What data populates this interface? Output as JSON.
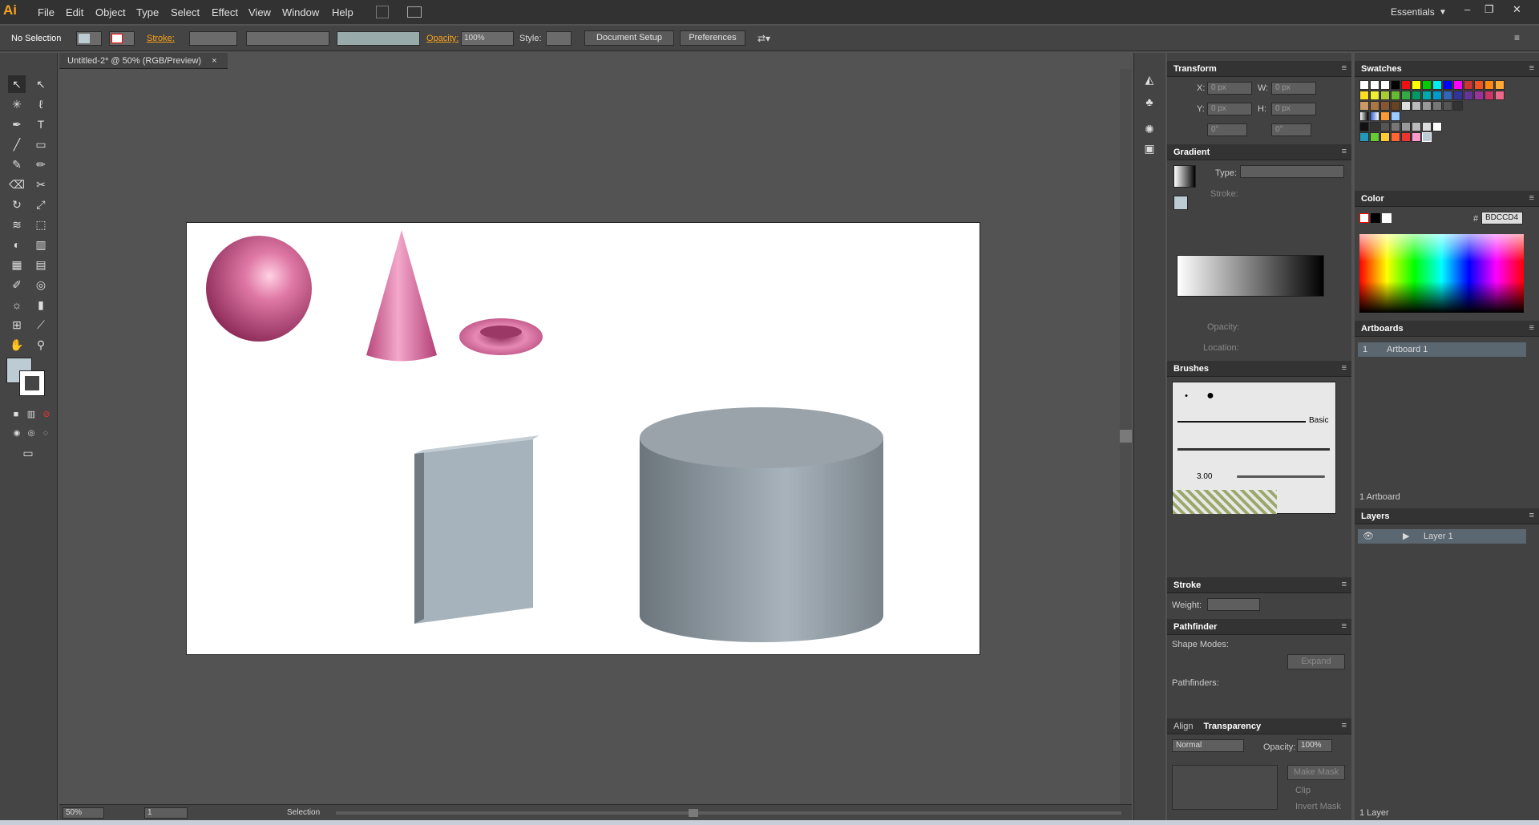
{
  "menubar": {
    "logo": "Ai",
    "items": [
      "File",
      "Edit",
      "Object",
      "Type",
      "Select",
      "Effect",
      "View",
      "Window",
      "Help"
    ],
    "workspace": "Essentials"
  },
  "controlbar": {
    "selection": "No Selection",
    "stroke_label": "Stroke:",
    "opacity_label": "Opacity:",
    "opacity_value": "100%",
    "style_label": "Style:",
    "document_setup": "Document Setup",
    "preferences": "Preferences"
  },
  "document": {
    "tab_title": "Untitled-2* @ 50% (RGB/Preview)"
  },
  "statusbar": {
    "zoom": "50%",
    "artboard_num": "1",
    "tool": "Selection"
  },
  "transform": {
    "title": "Transform",
    "x_label": "X:",
    "x": "0 px",
    "w_label": "W:",
    "w": "0 px",
    "y_label": "Y:",
    "y": "0 px",
    "h_label": "H:",
    "h": "0 px",
    "angle": "0°",
    "shear": "0°"
  },
  "gradient": {
    "title": "Gradient",
    "type_label": "Type:",
    "stroke_label": "Stroke:",
    "opacity_label": "Opacity:",
    "location_label": "Location:"
  },
  "brushes": {
    "title": "Brushes",
    "basic": "Basic",
    "size": "3.00"
  },
  "stroke": {
    "title": "Stroke",
    "weight_label": "Weight:"
  },
  "pathfinder": {
    "title": "Pathfinder",
    "shape_modes": "Shape Modes:",
    "expand": "Expand",
    "pathfinders": "Pathfinders:"
  },
  "transparency": {
    "align_tab": "Align",
    "title": "Transparency",
    "mode": "Normal",
    "opacity_label": "Opacity:",
    "opacity": "100%",
    "make_mask": "Make Mask",
    "clip": "Clip",
    "invert_mask": "Invert Mask"
  },
  "swatches": {
    "title": "Swatches"
  },
  "color": {
    "title": "Color",
    "hex_label": "#",
    "hex": "BDCCD4"
  },
  "artboards": {
    "title": "Artboards",
    "num": "1",
    "name": "Artboard 1",
    "count": "1 Artboard"
  },
  "layers": {
    "title": "Layers",
    "layer_name": "Layer 1",
    "count": "1 Layer"
  },
  "colors": {
    "fill": "#bdccd4",
    "accent": "#f7a21b",
    "shape_pink": "#d1679a",
    "shape_gray": "#a6b1b9"
  }
}
